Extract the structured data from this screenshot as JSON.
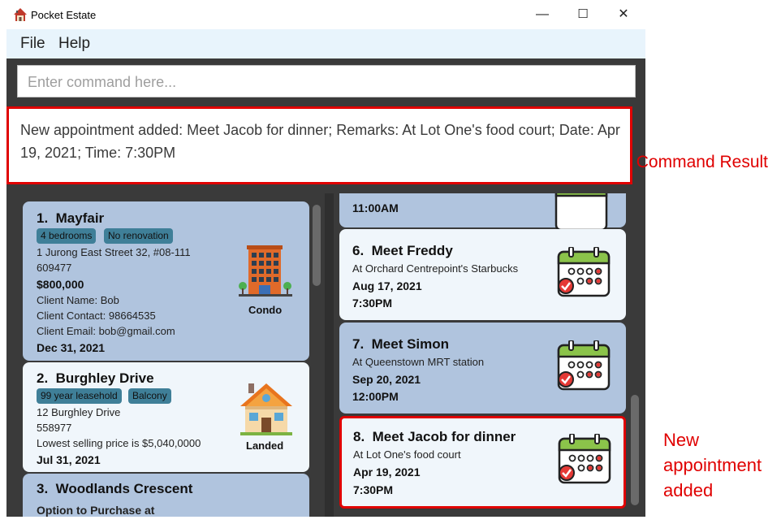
{
  "window": {
    "title": "Pocket Estate",
    "controls": {
      "minimize": "—",
      "maximize": "☐",
      "close": "✕"
    }
  },
  "menu": {
    "file": "File",
    "help": "Help"
  },
  "command": {
    "placeholder": "Enter command here..."
  },
  "result": {
    "text": "New appointment added: Meet Jacob for dinner; Remarks: At Lot One's food court; Date: Apr 19, 2021; Time: 7:30PM",
    "annotation": "Command Result"
  },
  "properties": [
    {
      "index": "1.",
      "name": "Mayfair",
      "tags": [
        "4 bedrooms",
        "No renovation"
      ],
      "address": "1 Jurong East Street 32, #08-111",
      "postal": "609477",
      "price": "$800,000",
      "client_name": "Client Name: Bob",
      "client_contact": "Client Contact: 98664535",
      "client_email": "Client Email: bob@gmail.com",
      "deadline": "Dec 31, 2021",
      "type": "Condo"
    },
    {
      "index": "2.",
      "name": "Burghley Drive",
      "tags": [
        "99 year leasehold",
        "Balcony"
      ],
      "address": "12 Burghley Drive",
      "postal": "558977",
      "remark": "Lowest selling price is $5,040,0000",
      "deadline": "Jul 31, 2021",
      "type": "Landed"
    },
    {
      "index": "3.",
      "name": "Woodlands Crescent",
      "remark": "Option to Purchase at"
    }
  ],
  "appointments": [
    {
      "time": "11:00AM"
    },
    {
      "index": "6.",
      "name": "Meet Freddy",
      "remark": "At Orchard Centrepoint's Starbucks",
      "date": "Aug 17, 2021",
      "time": "7:30PM"
    },
    {
      "index": "7.",
      "name": "Meet Simon",
      "remark": "At Queenstown MRT station",
      "date": "Sep 20, 2021",
      "time": "12:00PM"
    },
    {
      "index": "8.",
      "name": "Meet Jacob for dinner",
      "remark": "At Lot One's food court",
      "date": "Apr 19, 2021",
      "time": "7:30PM"
    }
  ],
  "annotation_new": [
    "New",
    "appointment",
    "added"
  ],
  "colors": {
    "card_blue": "#b0c4de",
    "card_light": "#f0f6fb",
    "tag": "#3f7f98",
    "highlight": "#e00000",
    "dark_bg": "#3a3a3a"
  }
}
